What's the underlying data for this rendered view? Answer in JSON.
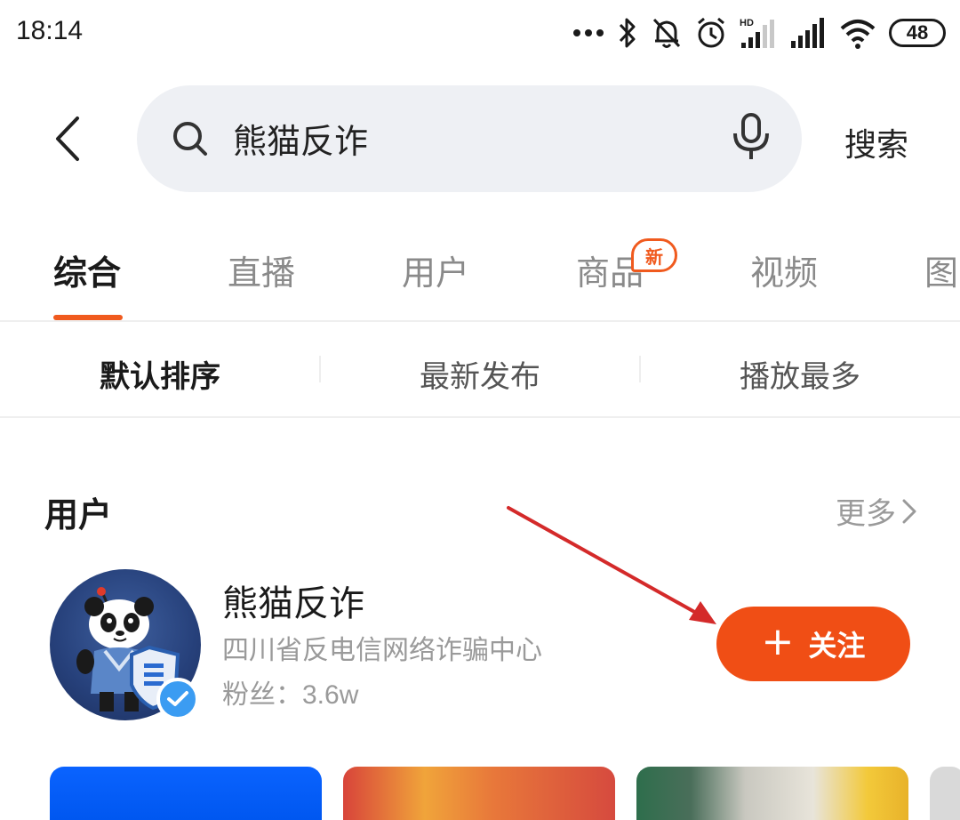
{
  "status_bar": {
    "time": "18:14",
    "battery": "48",
    "network_hd": "HD"
  },
  "search": {
    "query": "熊猫反诈",
    "submit_label": "搜索"
  },
  "tabs": [
    {
      "label": "综合",
      "active": true
    },
    {
      "label": "直播",
      "active": false
    },
    {
      "label": "用户",
      "active": false
    },
    {
      "label": "商品",
      "active": false,
      "badge": "新"
    },
    {
      "label": "视频",
      "active": false
    },
    {
      "label": "图",
      "active": false
    }
  ],
  "sort_options": [
    {
      "label": "默认排序",
      "active": true
    },
    {
      "label": "最新发布",
      "active": false
    },
    {
      "label": "播放最多",
      "active": false
    }
  ],
  "users_section": {
    "title": "用户",
    "more_label": "更多",
    "user": {
      "name": "熊猫反诈",
      "description": "四川省反电信网络诈骗中心",
      "fans_label": "粉丝：",
      "fans_count": "3.6w",
      "verified": true,
      "follow_label": "关注"
    }
  },
  "colors": {
    "accent": "#f04e15",
    "verified_blue": "#3b9cf2",
    "annotation_arrow": "#d42a2a"
  }
}
